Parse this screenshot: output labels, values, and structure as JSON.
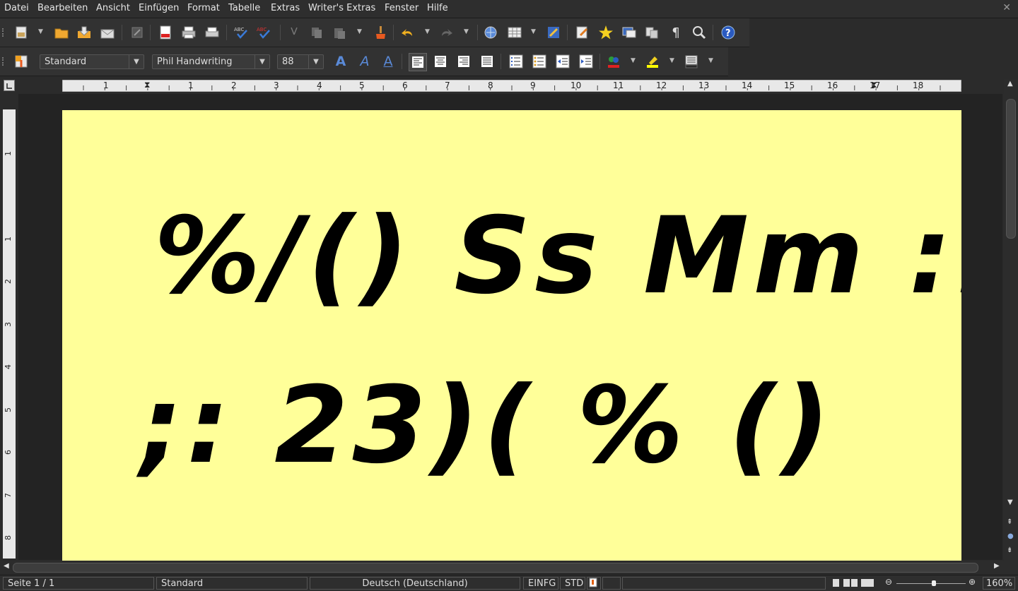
{
  "menubar": {
    "items": [
      "Datei",
      "Bearbeiten",
      "Ansicht",
      "Einfügen",
      "Format",
      "Tabelle",
      "Extras",
      "Writer's Extras",
      "Fenster",
      "Hilfe"
    ]
  },
  "format_bar": {
    "paragraph_style": "Standard",
    "font_name": "Phil Handwriting",
    "font_size": "88"
  },
  "ruler": {
    "h_numbers": [
      "1",
      "1",
      "2",
      "3",
      "4",
      "5",
      "6",
      "7",
      "8",
      "9",
      "10",
      "11",
      "12",
      "13",
      "14",
      "15",
      "16",
      "17",
      "18"
    ],
    "v_numbers": [
      "1",
      "1",
      "2",
      "3",
      "4",
      "5",
      "6",
      "7",
      "8"
    ]
  },
  "document": {
    "line1": "%/() Ss Mm :.",
    "line2": ";: 23)( % ()"
  },
  "statusbar": {
    "page": "Seite 1 / 1",
    "style": "Standard",
    "language": "Deutsch (Deutschland)",
    "insert_mode": "EINFG",
    "selection_mode": "STD",
    "zoom": "160%"
  },
  "colors": {
    "page_background": "#ffff99",
    "ui_background": "#2b2b2b"
  }
}
